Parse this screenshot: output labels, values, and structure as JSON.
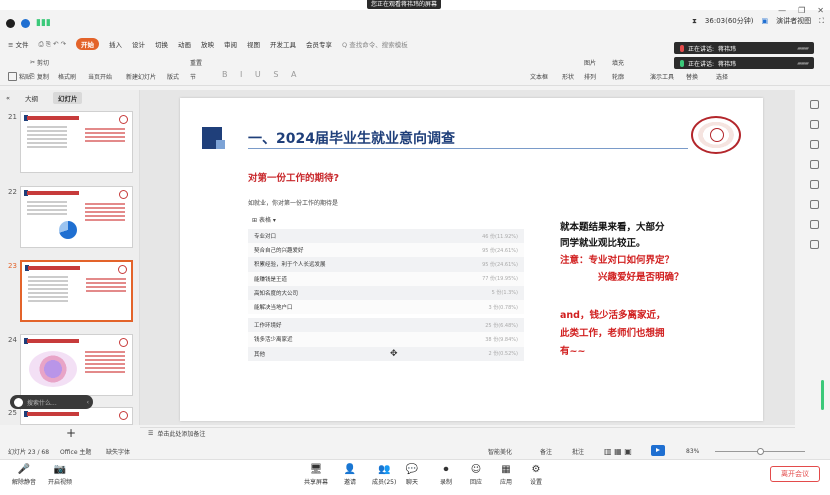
{
  "share_banner": {
    "text": "您正在观看蒋祎玮的屏幕 "
  },
  "titlebar": {
    "timer": "36:03(60分钟)",
    "view_mode": "演讲者视图"
  },
  "menu": [
    "≡ 文件",
    "开始",
    "插入",
    "设计",
    "切换",
    "动画",
    "放映",
    "审阅",
    "视图",
    "开发工具",
    "会员专享",
    "Q 查找命令、搜索模板"
  ],
  "ribbon": {
    "paste": "粘贴",
    "cut": "剪切",
    "copy": "复制",
    "format_painter": "格式刷",
    "current_start": "当页开始",
    "new_slide": "新建幻灯片",
    "layout": "版式",
    "section": "节",
    "reset": "重置",
    "text_box": "文本框",
    "shape": "形状",
    "arrange": "排列",
    "picture": "图片",
    "fill": "填充",
    "outline": "轮廓",
    "presentation_tools": "演示工具",
    "replace": "替换",
    "select": "选择"
  },
  "speaking": [
    {
      "label": "正在讲话:",
      "name": "蒋祎玮",
      "mic_color": "#e34b4b"
    },
    {
      "label": "正在讲话:",
      "name": "蒋祎玮",
      "mic_color": "#3bc97a"
    }
  ],
  "panel": {
    "tabs": [
      "大纲",
      "幻灯片"
    ],
    "active_tab": "幻灯片",
    "slides": [
      {
        "num": "21",
        "selected": false
      },
      {
        "num": "22",
        "selected": false
      },
      {
        "num": "23",
        "selected": true
      },
      {
        "num": "24",
        "selected": false
      },
      {
        "num": "25",
        "selected": false
      }
    ],
    "search_placeholder": "搜索什么..."
  },
  "slide": {
    "title": "一、2024届毕业生就业意向调查",
    "subtitle": "对第一份工作的期待?",
    "question": "如就业，你对第一份工作的期待是",
    "table_tag": "表格",
    "rows": [
      {
        "label": "专业对口",
        "value": "46 份(11.92%)"
      },
      {
        "label": "契合自己的兴趣爱好",
        "value": "95 份(24.61%)"
      },
      {
        "label": "积累经验，利于个人长远发展",
        "value": "95 份(24.61%)"
      },
      {
        "label": "能赚钱是王道",
        "value": "77 份(19.95%)"
      },
      {
        "label": "高知名度的大公司",
        "value": "5 份(1.3%)"
      },
      {
        "label": "能解决当地户口",
        "value": "3 份(0.78%)"
      },
      {
        "label": "工作环境好",
        "value": "25 份(6.48%)"
      },
      {
        "label": "钱多活少离家近",
        "value": "38 份(9.84%)"
      },
      {
        "label": "其他",
        "value": "2 份(0.52%)"
      }
    ],
    "comment_lines": [
      {
        "text": "就本题结果来看，大部分",
        "color": "black",
        "indent": 0
      },
      {
        "text": "同学就业观比较正。",
        "color": "black",
        "indent": 0
      },
      {
        "text": "注意：专业对口如何界定？",
        "color": "red",
        "indent": 0
      },
      {
        "text": "兴趣爱好是否明确？",
        "color": "red",
        "indent": 38
      }
    ],
    "comment_lines_2": [
      {
        "text": "and，钱少活多离家近，",
        "color": "red"
      },
      {
        "text": "此类工作，老师们也想拥",
        "color": "red"
      },
      {
        "text": "有~~",
        "color": "red"
      }
    ]
  },
  "notes_placeholder": "单击此处添加备注",
  "status": {
    "slide_info": "幻灯片 23 / 68",
    "theme": "Office 主题",
    "missing_font": "缺失字体",
    "beautify": "智能美化",
    "notes": "备注",
    "comments": "批注",
    "zoom": "83%"
  },
  "meeting": {
    "buttons": [
      {
        "label": "解除静音",
        "icon": "🎤"
      },
      {
        "label": "开启视频",
        "icon": "📷"
      },
      {
        "label": "共享屏幕",
        "icon": "🖥"
      },
      {
        "label": "邀请",
        "icon": "👤"
      },
      {
        "label": "成员(25)",
        "icon": "👥"
      },
      {
        "label": "聊天",
        "icon": "💬"
      },
      {
        "label": "录制",
        "icon": "⏺"
      },
      {
        "label": "回应",
        "icon": "☺"
      },
      {
        "label": "应用",
        "icon": "▦"
      },
      {
        "label": "设置",
        "icon": "⚙"
      }
    ],
    "leave": "离开会议"
  },
  "colors": {
    "accent": "#e3632a",
    "slide_title": "#1f3f7a",
    "slide_red": "#c8272b"
  }
}
